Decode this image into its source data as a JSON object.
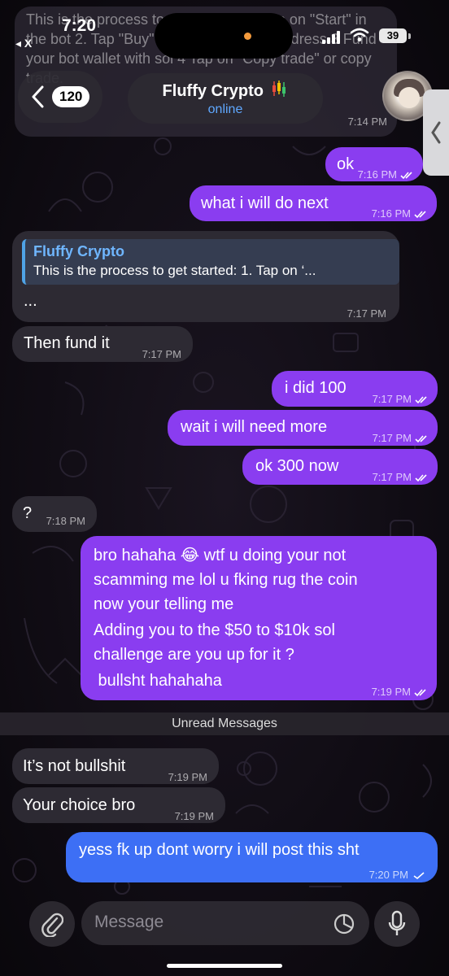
{
  "status_bar": {
    "time": "7:20",
    "back_app": "◂ X",
    "battery": "39"
  },
  "faded_message": {
    "text": "This is the process to get started:  1. Tap on \"Start\" in the bot   2. Tap \"Buy\" then copy the bot address   3 Fund your bot wallet with sol   4 Tap on \"Copy trade\" or copy trade.",
    "time": "7:14 PM"
  },
  "header": {
    "back_count": "120",
    "contact_name": "Fluffy Crypto",
    "contact_status": "online"
  },
  "messages": [
    {
      "id": "m1",
      "direction": "out",
      "text": "ok",
      "time": "7:16 PM"
    },
    {
      "id": "m2",
      "direction": "out",
      "text": "what i will do next",
      "time": "7:16 PM"
    },
    {
      "id": "m3",
      "direction": "in",
      "reply_name": "Fluffy Crypto",
      "reply_text": "This is the process to get started: 1. Tap on ‘...",
      "text": "...",
      "time": "7:17 PM"
    },
    {
      "id": "m4",
      "direction": "in",
      "text": "Then fund it",
      "time": "7:17 PM"
    },
    {
      "id": "m5",
      "direction": "out",
      "text": "i did 100",
      "time": "7:17 PM"
    },
    {
      "id": "m6",
      "direction": "out",
      "text": "wait i will need more",
      "time": "7:17 PM"
    },
    {
      "id": "m7",
      "direction": "out",
      "text": "ok 300 now",
      "time": "7:17 PM"
    },
    {
      "id": "m8",
      "direction": "in",
      "text": "?",
      "time": "7:18 PM"
    },
    {
      "id": "m9",
      "direction": "out",
      "lines": [
        "bro hahaha 😂 wtf u doing your not",
        "scamming me lol  u fking rug the coin",
        "now your telling me",
        "Adding you to the $50 to $10k sol",
        "challenge are you up for it ?",
        " bullsht hahahaha"
      ],
      "time": "7:19 PM"
    },
    {
      "id": "m10",
      "direction": "in",
      "text": "It’s not bullshit",
      "time": "7:19 PM"
    },
    {
      "id": "m11",
      "direction": "in",
      "text": "Your choice bro",
      "time": "7:19 PM"
    },
    {
      "id": "m12",
      "direction": "out",
      "text": "yess fk up dont worry i will post this sht",
      "time": "7:20 PM"
    }
  ],
  "unread_label": "Unread Messages",
  "input": {
    "placeholder": "Message"
  },
  "colors": {
    "outgoing": "#8a3df0",
    "outgoing_last": "#3d6ff5",
    "incoming": "#2d2a33",
    "link": "#5fa8ff",
    "reply_accent": "#4fa3e6"
  }
}
